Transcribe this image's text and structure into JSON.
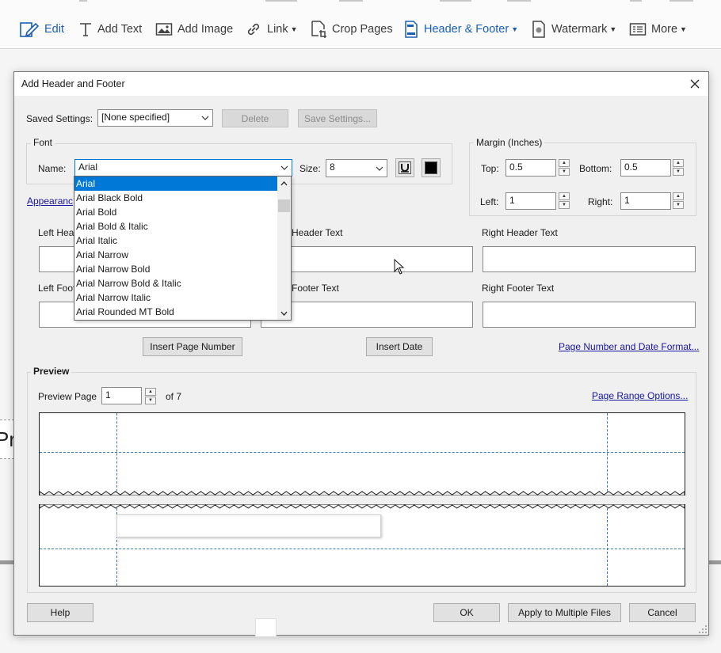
{
  "toolbar": {
    "items": [
      {
        "label": "Edit",
        "icon": "edit-icon"
      },
      {
        "label": "Add Text",
        "icon": "add-text-icon"
      },
      {
        "label": "Add Image",
        "icon": "add-image-icon"
      },
      {
        "label": "Link",
        "icon": "link-icon"
      },
      {
        "label": "Crop Pages",
        "icon": "crop-pages-icon"
      },
      {
        "label": "Header & Footer",
        "icon": "header-footer-icon"
      },
      {
        "label": "Watermark",
        "icon": "watermark-icon"
      },
      {
        "label": "More",
        "icon": "more-icon"
      }
    ],
    "accent_color": "#1a5fb4"
  },
  "document": {
    "partial_text": "Pr"
  },
  "dialog": {
    "title": "Add Header and Footer",
    "saved_settings": {
      "label": "Saved Settings:",
      "value": "[None specified]",
      "delete_label": "Delete",
      "save_label": "Save Settings..."
    },
    "font": {
      "group_label": "Font",
      "name_label": "Name:",
      "name_value": "Arial",
      "size_label": "Size:",
      "size_value": "8",
      "color": "#000000",
      "options": [
        "Arial",
        "Arial Black Bold",
        "Arial Bold",
        "Arial Bold & Italic",
        "Arial Italic",
        "Arial Narrow",
        "Arial Narrow Bold",
        "Arial Narrow Bold & Italic",
        "Arial Narrow Italic",
        "Arial Rounded MT Bold"
      ],
      "selected_index": 0
    },
    "margin": {
      "group_label": "Margin (Inches)",
      "top_label": "Top:",
      "top_value": "0.5",
      "bottom_label": "Bottom:",
      "bottom_value": "0.5",
      "left_label": "Left:",
      "left_value": "1",
      "right_label": "Right:",
      "right_value": "1"
    },
    "appearance_link": "Appearanc",
    "header": {
      "left_label": "Left Hea",
      "center_label": "Header Text",
      "right_label": "Right Header Text"
    },
    "footer": {
      "left_label": "Left Foot",
      "center_label": "Footer Text",
      "right_label": "Right Footer Text"
    },
    "insert_page_number": "Insert Page Number",
    "insert_date": "Insert Date",
    "page_number_format_link": "Page Number and Date Format...",
    "preview": {
      "group_label": "Preview",
      "page_label": "Preview Page",
      "page_value": "1",
      "of_label": "of 7",
      "range_link": "Page Range Options..."
    },
    "buttons": {
      "help": "Help",
      "ok": "OK",
      "apply_multiple": "Apply to Multiple Files",
      "cancel": "Cancel"
    }
  }
}
